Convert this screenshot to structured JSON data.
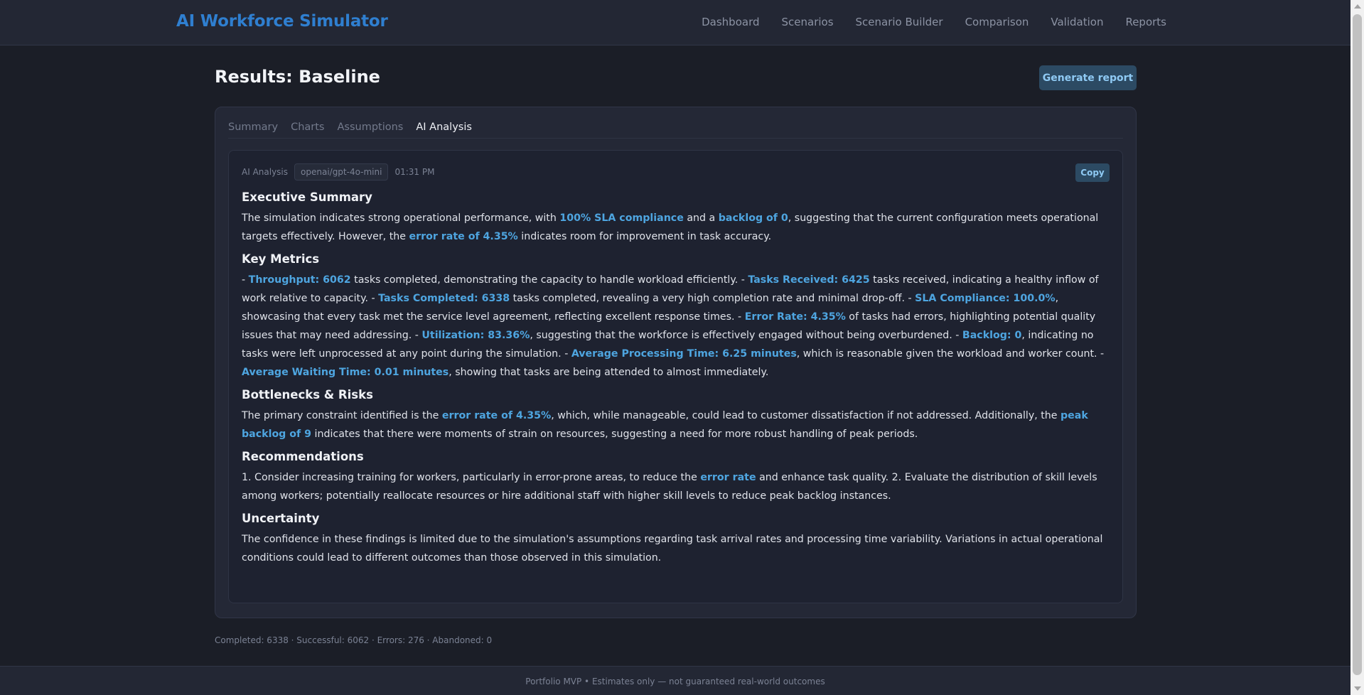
{
  "app": {
    "title": "AI Workforce Simulator"
  },
  "nav": [
    "Dashboard",
    "Scenarios",
    "Scenario Builder",
    "Comparison",
    "Validation",
    "Reports"
  ],
  "page": {
    "title": "Results: Baseline",
    "generate_label": "Generate report"
  },
  "tabs": [
    {
      "label": "Summary",
      "active": false
    },
    {
      "label": "Charts",
      "active": false
    },
    {
      "label": "Assumptions",
      "active": false
    },
    {
      "label": "AI Analysis",
      "active": true
    }
  ],
  "analysis": {
    "label": "AI Analysis",
    "model": "openai/gpt-4o-mini",
    "time": "01:31 PM",
    "copy_label": "Copy",
    "sections": [
      {
        "heading": "Executive Summary",
        "parts": [
          {
            "t": "The simulation indicates strong operational performance, with "
          },
          {
            "t": "100% SLA compliance",
            "hl": true
          },
          {
            "t": " and a "
          },
          {
            "t": "backlog of 0",
            "hl": true
          },
          {
            "t": ", suggesting that the current configuration meets operational targets effectively. However, the "
          },
          {
            "t": "error rate of 4.35%",
            "hl": true
          },
          {
            "t": " indicates room for improvement in task accuracy."
          }
        ]
      },
      {
        "heading": "Key Metrics",
        "parts": [
          {
            "t": "- "
          },
          {
            "t": "Throughput: 6062",
            "hl": true
          },
          {
            "t": " tasks completed, demonstrating the capacity to handle workload efficiently. - "
          },
          {
            "t": "Tasks Received: 6425",
            "hl": true
          },
          {
            "t": " tasks received, indicating a healthy inflow of work relative to capacity. - "
          },
          {
            "t": "Tasks Completed: 6338",
            "hl": true
          },
          {
            "t": " tasks completed, revealing a very high completion rate and minimal drop-off. - "
          },
          {
            "t": "SLA Compliance: 100.0%",
            "hl": true
          },
          {
            "t": ", showcasing that every task met the service level agreement, reflecting excellent response times. - "
          },
          {
            "t": "Error Rate: 4.35%",
            "hl": true
          },
          {
            "t": " of tasks had errors, highlighting potential quality issues that may need addressing. - "
          },
          {
            "t": "Utilization: 83.36%",
            "hl": true
          },
          {
            "t": ", suggesting that the workforce is effectively engaged without being overburdened. - "
          },
          {
            "t": "Backlog: 0",
            "hl": true
          },
          {
            "t": ", indicating no tasks were left unprocessed at any point during the simulation. - "
          },
          {
            "t": "Average Processing Time: 6.25 minutes",
            "hl": true
          },
          {
            "t": ", which is reasonable given the workload and worker count. - "
          },
          {
            "t": "Average Waiting Time: 0.01 minutes",
            "hl": true
          },
          {
            "t": ", showing that tasks are being attended to almost immediately."
          }
        ]
      },
      {
        "heading": "Bottlenecks & Risks",
        "parts": [
          {
            "t": "The primary constraint identified is the "
          },
          {
            "t": "error rate of 4.35%",
            "hl": true
          },
          {
            "t": ", which, while manageable, could lead to customer dissatisfaction if not addressed. Additionally, the "
          },
          {
            "t": "peak backlog of 9",
            "hl": true
          },
          {
            "t": " indicates that there were moments of strain on resources, suggesting a need for more robust handling of peak periods."
          }
        ]
      },
      {
        "heading": "Recommendations",
        "parts": [
          {
            "t": "1. Consider increasing training for workers, particularly in error-prone areas, to reduce the "
          },
          {
            "t": "error rate",
            "hl": true
          },
          {
            "t": " and enhance task quality. 2. Evaluate the distribution of skill levels among workers; potentially reallocate resources or hire additional staff with higher skill levels to reduce peak backlog instances."
          }
        ]
      },
      {
        "heading": "Uncertainty",
        "parts": [
          {
            "t": "The confidence in these findings is limited due to the simulation's assumptions regarding task arrival rates and processing time variability. Variations in actual operational conditions could lead to different outcomes than those observed in this simulation."
          }
        ]
      }
    ]
  },
  "footer": {
    "stats": "Completed: 6338 · Successful: 6062 · Errors: 276 · Abandoned: 0",
    "disclaimer": "Portfolio MVP • Estimates only — not guaranteed real-world outcomes"
  }
}
